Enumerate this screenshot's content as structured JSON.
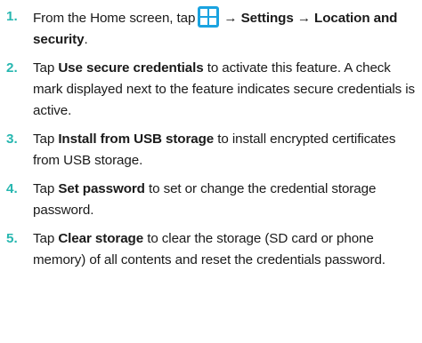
{
  "steps": [
    {
      "number": "1.",
      "text_a": "From the Home screen, tap",
      "icon": "apps-grid-icon",
      "arrow_1": "→",
      "settings": "Settings",
      "arrow_2": "→",
      "location": "Location and security",
      "end": "."
    },
    {
      "number": "2.",
      "pre": "Tap ",
      "bold": "Use secure credentials",
      "post": " to activate this feature. A check mark displayed next to the feature indicates secure credentials is active."
    },
    {
      "number": "3.",
      "pre": "Tap ",
      "bold": "Install from USB storage",
      "post": " to install encrypted certificates from USB storage."
    },
    {
      "number": "4.",
      "pre": "Tap ",
      "bold": "Set password",
      "post": " to set or change the credential storage password."
    },
    {
      "number": "5.",
      "pre": "Tap ",
      "bold": "Clear storage",
      "post": " to clear the storage (SD card or phone memory) of all contents and reset the credentials password."
    }
  ],
  "colors": {
    "step_number": "#27b7b0",
    "icon_fill": "#1aa3e0",
    "text": "#1a1a1a"
  }
}
